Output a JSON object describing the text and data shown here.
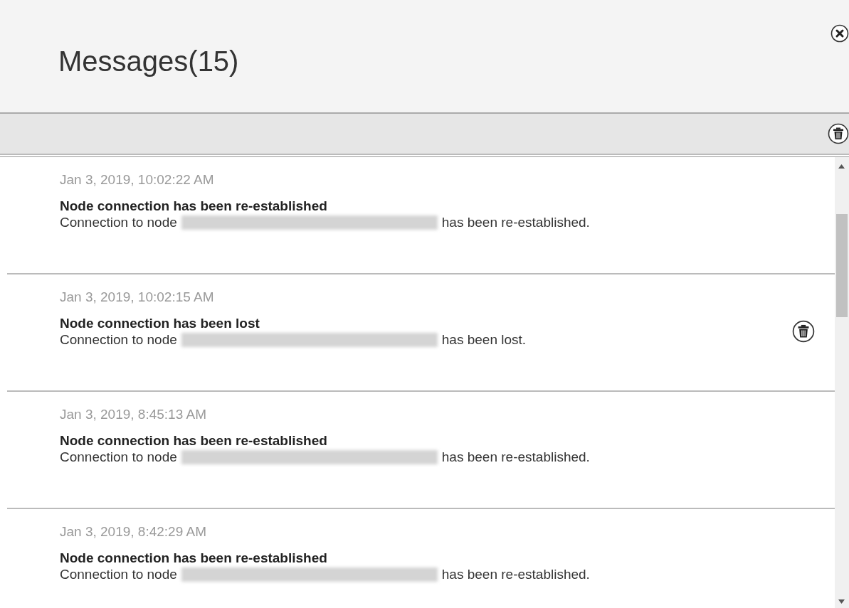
{
  "header": {
    "title": "Messages(15)"
  },
  "messages": [
    {
      "time": "Jan 3, 2019, 10:02:22 AM",
      "title": "Node connection has been re-established",
      "body_start": "Connection to node",
      "body_end": "has been re-established.",
      "show_delete": false
    },
    {
      "time": "Jan 3, 2019, 10:02:15 AM",
      "title": "Node connection has been lost",
      "body_start": "Connection to node",
      "body_end": "has been lost.",
      "show_delete": true
    },
    {
      "time": "Jan 3, 2019, 8:45:13 AM",
      "title": "Node connection has been re-established",
      "body_start": "Connection to node",
      "body_end": "has been re-established.",
      "show_delete": false
    },
    {
      "time": "Jan 3, 2019, 8:42:29 AM",
      "title": "Node connection has been re-established",
      "body_start": "Connection to node",
      "body_end": "has been re-established.",
      "show_delete": false
    }
  ]
}
